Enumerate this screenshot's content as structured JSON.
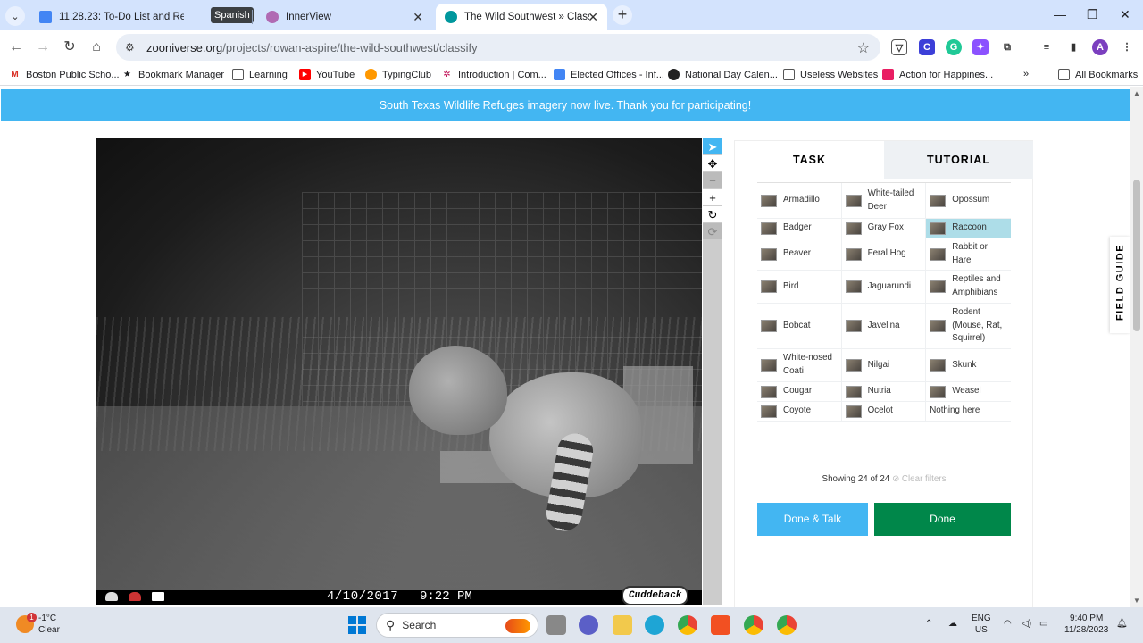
{
  "browser": {
    "tabs": [
      {
        "title": "11.28.23: To-Do List and Remin",
        "icon": "docs-icon"
      },
      {
        "title": "InnerView",
        "icon": "innerview-icon"
      },
      {
        "title": "The Wild Southwest » Classify",
        "icon": "zooniverse-icon"
      }
    ],
    "tooltip": "Spanish",
    "url_domain": "zooniverse.org",
    "url_path": "/projects/rowan-aspire/the-wild-southwest/classify",
    "bookmarks": [
      "Boston Public Scho...",
      "Bookmark Manager",
      "Learning",
      "YouTube",
      "TypingClub",
      "Introduction | Com...",
      "Elected Offices - Inf...",
      "National Day Calen...",
      "Useless Websites",
      "Action for Happines..."
    ],
    "all_bookmarks": "All Bookmarks",
    "more_bookmarks": "»"
  },
  "banner": "South Texas Wildlife Refuges imagery now live. Thank you for participating!",
  "photo": {
    "date": "4/10/2017",
    "time": "9:22 PM",
    "brand": "Cuddeback"
  },
  "panel": {
    "tab_task": "TASK",
    "tab_tutorial": "TUTORIAL",
    "species": [
      [
        "Armadillo",
        "White-tailed Deer",
        "Opossum"
      ],
      [
        "Badger",
        "Gray Fox",
        "Raccoon"
      ],
      [
        "Beaver",
        "Feral Hog",
        "Rabbit or Hare"
      ],
      [
        "Bird",
        "Jaguarundi",
        "Reptiles and Amphibians"
      ],
      [
        "Bobcat",
        "Javelina",
        "Rodent (Mouse, Rat, Squirrel)"
      ],
      [
        "White-nosed Coati",
        "Nilgai",
        "Skunk"
      ],
      [
        "Cougar",
        "Nutria",
        "Weasel"
      ],
      [
        "Coyote",
        "Ocelot",
        "Nothing here"
      ]
    ],
    "selected": "Raccoon",
    "showing": "Showing 24 of 24",
    "clear_filters": "Clear filters",
    "done_talk": "Done & Talk",
    "done": "Done"
  },
  "field_guide": "FIELD GUIDE",
  "taskbar": {
    "temp": "-1°C",
    "weather": "Clear",
    "weather_badge": "1",
    "search": "Search",
    "lang1": "ENG",
    "lang2": "US",
    "time": "9:40 PM",
    "date": "11/28/2023"
  },
  "colors": {
    "accent": "#43b6f2",
    "done": "#00874a",
    "selected": "#addde8"
  }
}
